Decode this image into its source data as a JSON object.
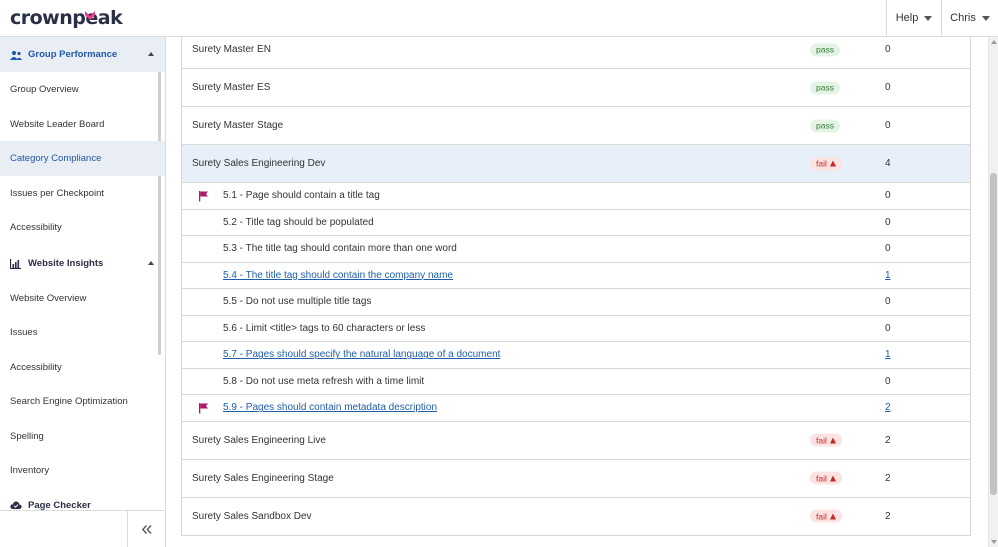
{
  "app": {
    "logo_text": "crownpeak",
    "brand_color": "#e83e8c"
  },
  "topnav": {
    "help_label": "Help",
    "user_label": "Chris"
  },
  "sidebar": {
    "sections": [
      {
        "label": "Group Performance",
        "icon": "users-icon",
        "expanded": true
      },
      {
        "label": "Website Insights",
        "icon": "chart-icon",
        "expanded": true
      },
      {
        "label": "Page Checker",
        "icon": "cloud-check-icon"
      }
    ],
    "group_items": [
      {
        "label": "Group Overview"
      },
      {
        "label": "Website Leader Board"
      },
      {
        "label": "Category Compliance",
        "active": true
      },
      {
        "label": "Issues per Checkpoint"
      },
      {
        "label": "Accessibility"
      }
    ],
    "insight_items": [
      {
        "label": "Website Overview"
      },
      {
        "label": "Issues"
      },
      {
        "label": "Accessibility"
      },
      {
        "label": "Search Engine Optimization"
      },
      {
        "label": "Spelling"
      },
      {
        "label": "Inventory"
      }
    ],
    "collapse_icon": "double-chevron-left-icon"
  },
  "table": {
    "rows": [
      {
        "type": "site",
        "name": "Surety Master EN",
        "status": "pass",
        "count": "0"
      },
      {
        "type": "site",
        "name": "Surety Master ES",
        "status": "pass",
        "count": "0"
      },
      {
        "type": "site",
        "name": "Surety Master Stage",
        "status": "pass",
        "count": "0"
      },
      {
        "type": "site",
        "name": "Surety Sales Engineering Dev",
        "status": "fail",
        "count": "4",
        "expanded": true
      },
      {
        "type": "check",
        "name": "5.1 - Page should contain a title tag",
        "count": "0",
        "flag": true
      },
      {
        "type": "check",
        "name": "5.2 - Title tag should be populated",
        "count": "0"
      },
      {
        "type": "check",
        "name": "5.3 - The title tag should contain more than one word",
        "count": "0"
      },
      {
        "type": "check",
        "name": "5.4 - The title tag should contain the company name",
        "count": "1",
        "link": true
      },
      {
        "type": "check",
        "name": "5.5 - Do not use multiple title tags",
        "count": "0"
      },
      {
        "type": "check",
        "name": "5.6 - Limit <title> tags to 60 characters or less",
        "count": "0"
      },
      {
        "type": "check",
        "name": "5.7 - Pages should specify the natural language of a document",
        "count": "1",
        "link": true
      },
      {
        "type": "check",
        "name": "5.8 - Do not use meta refresh with a time limit",
        "count": "0"
      },
      {
        "type": "check",
        "name": "5.9 - Pages should contain metadata description",
        "count": "2",
        "link": true,
        "flag": true
      },
      {
        "type": "site",
        "name": "Surety Sales Engineering Live",
        "status": "fail",
        "count": "2"
      },
      {
        "type": "site",
        "name": "Surety Sales Engineering Stage",
        "status": "fail",
        "count": "2"
      },
      {
        "type": "site",
        "name": "Surety Sales Sandbox Dev",
        "status": "fail",
        "count": "2"
      }
    ]
  }
}
